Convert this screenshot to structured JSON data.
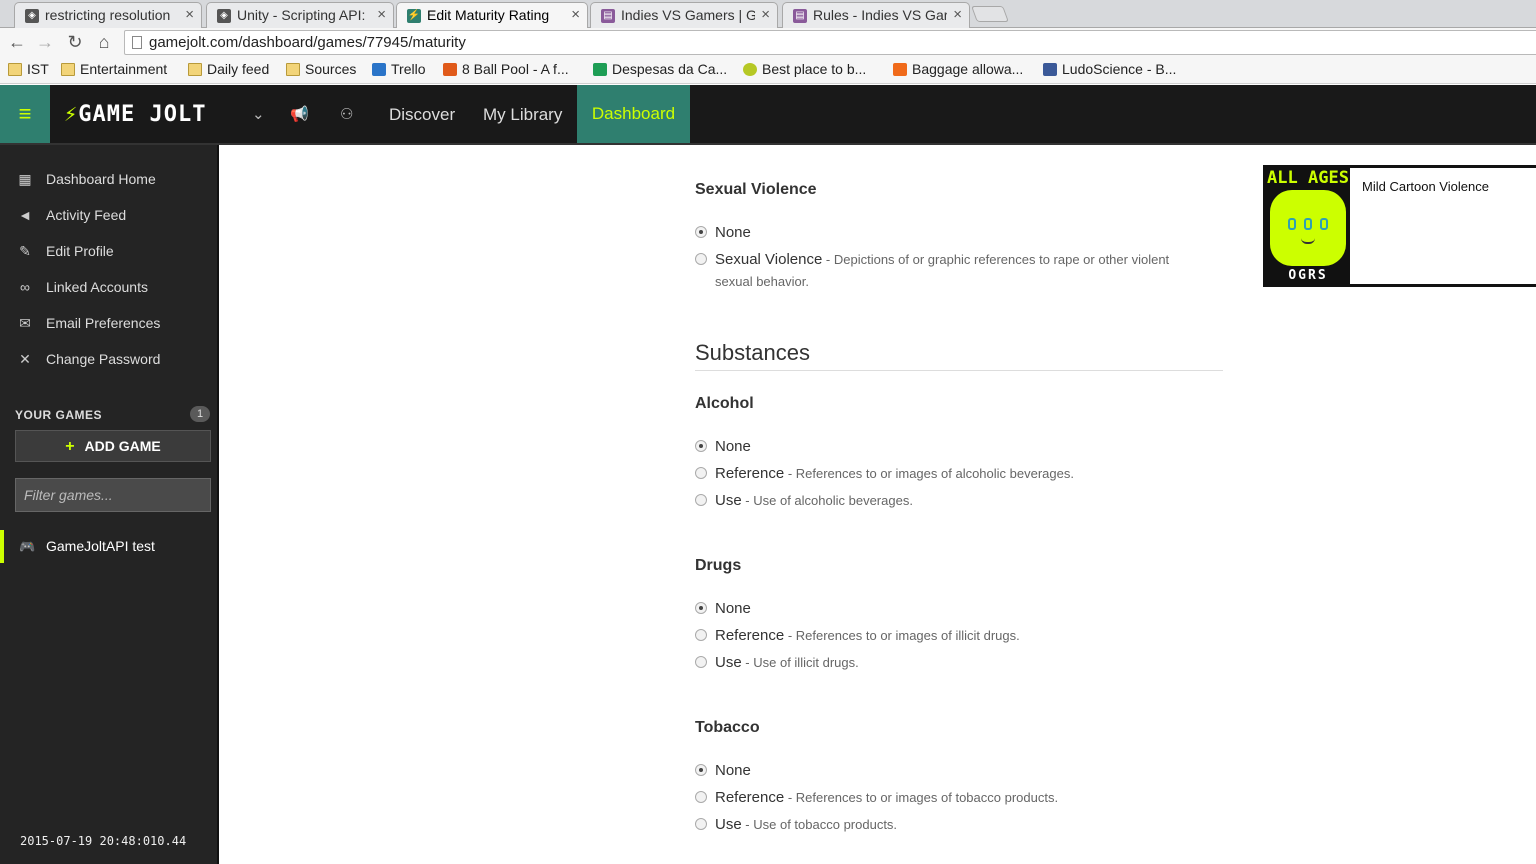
{
  "browser": {
    "tabs": [
      {
        "title": "restricting resolution",
        "favicon": "unity-icon"
      },
      {
        "title": "Unity - Scripting API:",
        "favicon": "unity-icon"
      },
      {
        "title": "Edit Maturity Rating",
        "favicon": "gamejolt-icon"
      },
      {
        "title": "Indies VS Gamers | G",
        "favicon": "page-icon"
      },
      {
        "title": "Rules - Indies VS Gar",
        "favicon": "page-icon"
      }
    ],
    "url": "gamejolt.com/dashboard/games/77945/maturity",
    "bookmarks": [
      {
        "label": "IST",
        "icon": "folder-icon"
      },
      {
        "label": "Entertainment",
        "icon": "folder-icon"
      },
      {
        "label": "Daily feed",
        "icon": "folder-icon"
      },
      {
        "label": "Sources",
        "icon": "folder-icon"
      },
      {
        "label": "Trello",
        "icon": "trello-icon"
      },
      {
        "label": "8 Ball Pool - A f...",
        "icon": "play-icon"
      },
      {
        "label": "Despesas da Ca...",
        "icon": "sheets-icon"
      },
      {
        "label": "Best place to b...",
        "icon": "smiley-icon"
      },
      {
        "label": "Baggage allowa...",
        "icon": "easyjet-icon"
      },
      {
        "label": "LudoScience - B...",
        "icon": "facebook-icon"
      }
    ]
  },
  "topnav": {
    "logo": "GAME JOLT",
    "links": [
      "Discover",
      "My Library",
      "Dashboard"
    ],
    "active": "Dashboard"
  },
  "sidebar": {
    "items": [
      {
        "label": "Dashboard Home",
        "icon": "dashboard-icon"
      },
      {
        "label": "Activity Feed",
        "icon": "megaphone-icon"
      },
      {
        "label": "Edit Profile",
        "icon": "pencil-icon"
      },
      {
        "label": "Linked Accounts",
        "icon": "link-icon"
      },
      {
        "label": "Email Preferences",
        "icon": "envelope-icon"
      },
      {
        "label": "Change Password",
        "icon": "tools-icon"
      }
    ],
    "your_games_label": "YOUR GAMES",
    "your_games_count": "1",
    "add_game_label": "ADD GAME",
    "filter_placeholder": "Filter games...",
    "games": [
      "GameJoltAPI test"
    ],
    "timestamp": "2015-07-19 20:48:010.44"
  },
  "main": {
    "sexual_violence": {
      "heading": "Sexual Violence",
      "options": [
        {
          "label": "None",
          "desc": "",
          "selected": true
        },
        {
          "label": "Sexual Violence",
          "desc": " - Depictions of or graphic references to rape or other violent sexual behavior.",
          "selected": false
        }
      ]
    },
    "substances_heading": "Substances",
    "alcohol": {
      "heading": "Alcohol",
      "options": [
        {
          "label": "None",
          "desc": "",
          "selected": true
        },
        {
          "label": "Reference",
          "desc": " - References to or images of alcoholic beverages.",
          "selected": false
        },
        {
          "label": "Use",
          "desc": " - Use of alcoholic beverages.",
          "selected": false
        }
      ]
    },
    "drugs": {
      "heading": "Drugs",
      "options": [
        {
          "label": "None",
          "desc": "",
          "selected": true
        },
        {
          "label": "Reference",
          "desc": " - References to or images of illicit drugs.",
          "selected": false
        },
        {
          "label": "Use",
          "desc": " - Use of illicit drugs.",
          "selected": false
        }
      ]
    },
    "tobacco": {
      "heading": "Tobacco",
      "options": [
        {
          "label": "None",
          "desc": "",
          "selected": true
        },
        {
          "label": "Reference",
          "desc": " - References to or images of tobacco products.",
          "selected": false
        },
        {
          "label": "Use",
          "desc": " - Use of tobacco products.",
          "selected": false
        }
      ]
    },
    "rating_card": {
      "badge_top": "ALL AGES",
      "badge_bottom": "OGRS",
      "description": "Mild Cartoon Violence"
    }
  },
  "colors": {
    "accent": "#ccff00",
    "active_bg": "#2f7f6f",
    "nav_bg": "#191919",
    "sidebar_bg": "#242424"
  }
}
